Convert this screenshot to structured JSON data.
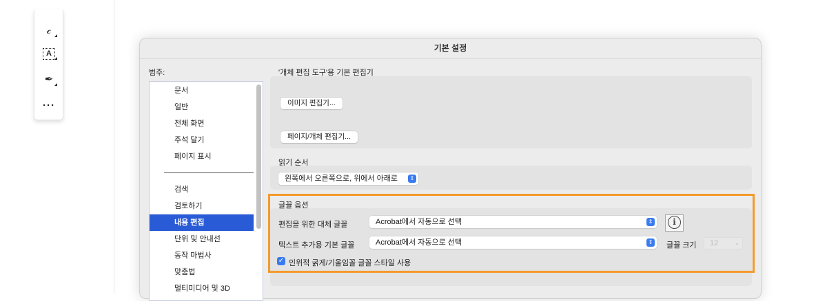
{
  "toolbar": {
    "tools": [
      {
        "icon": "lasso-icon",
        "glyph": "ᘓ"
      },
      {
        "icon": "text-select-icon",
        "glyph": "A"
      },
      {
        "icon": "pen-signature-icon",
        "glyph": "✒"
      },
      {
        "icon": "more-icon",
        "glyph": "···"
      }
    ]
  },
  "dialog": {
    "title": "기본 설정",
    "category_label": "범주:",
    "categories_top": [
      "문서",
      "일반",
      "전체 화면",
      "주석 달기",
      "페이지 표시"
    ],
    "categories_bottom": [
      "검색",
      "검토하기",
      "내용 편집",
      "단위 및 안내선",
      "동작 마법사",
      "맞춤법",
      "멀티미디어 및 3D"
    ],
    "selected_category": "내용 편집",
    "editor_section": {
      "heading": "'개체 편집 도구'용 기본 편집기",
      "image_editor_button": "이미지 편집기...",
      "page_object_editor_button": "페이지/개체 편집기..."
    },
    "reading_order": {
      "heading": "읽기 순서",
      "value": "왼쪽에서 오른쪽으로, 위에서 아래로"
    },
    "font_options": {
      "heading": "글꼴 옵션",
      "fallback_label": "편집을 위한 대체 글꼴",
      "fallback_value": "Acrobat에서 자동으로 선택",
      "default_label": "텍스트 추가용 기본 글꼴",
      "default_value": "Acrobat에서 자동으로 선택",
      "size_label": "글꼴 크기",
      "size_value": "12",
      "synthetic_style_label": "인위적 굵게/기울임꼴 글꼴 스타일 사용",
      "synthetic_style_checked": true
    },
    "colors": {
      "selection": "#2a5bd7",
      "highlight": "#f39a2b"
    }
  }
}
